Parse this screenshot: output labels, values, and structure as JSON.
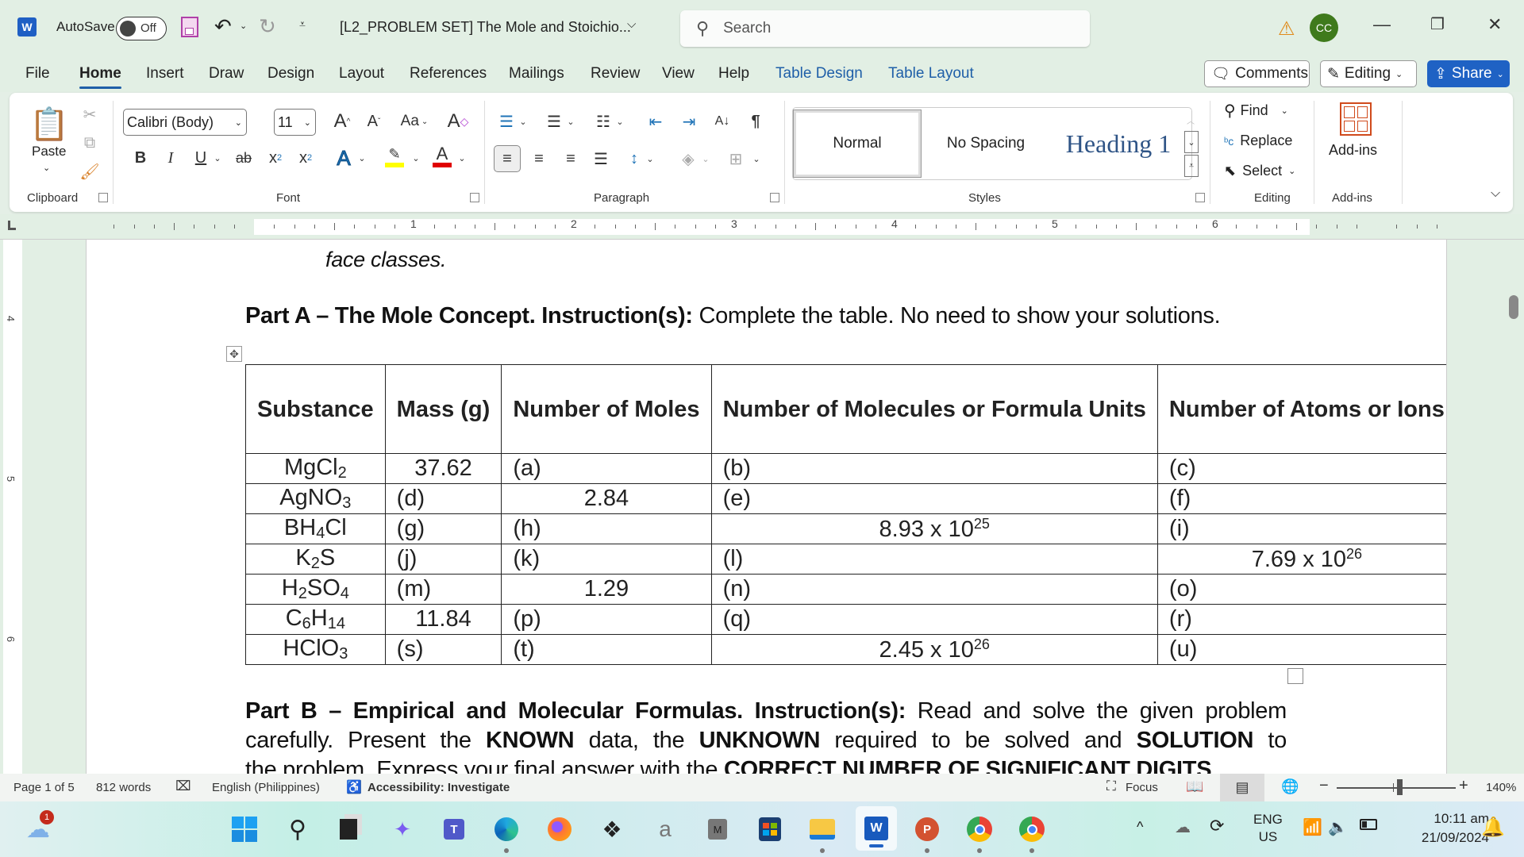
{
  "titlebar": {
    "app_icon": "word-icon",
    "autosave_label": "AutoSave",
    "autosave_state": "Off",
    "doc_title": "[L2_PROBLEM SET] The Mole and Stoichio...",
    "search_placeholder": "Search",
    "user_initials": "CC",
    "warning_icon": "warning-icon"
  },
  "menu": {
    "tabs": [
      "File",
      "Home",
      "Insert",
      "Draw",
      "Design",
      "Layout",
      "References",
      "Mailings",
      "Review",
      "View",
      "Help",
      "Table Design",
      "Table Layout"
    ],
    "active_tab": "Home",
    "comments_label": "Comments",
    "editing_label": "Editing",
    "share_label": "Share"
  },
  "ribbon": {
    "clipboard": {
      "paste_label": "Paste",
      "group_label": "Clipboard"
    },
    "font": {
      "font_name": "Calibri (Body)",
      "font_size": "11",
      "case_label": "Aa",
      "group_label": "Font",
      "highlight_color": "#ffff00",
      "font_color": "#e00000"
    },
    "paragraph": {
      "group_label": "Paragraph"
    },
    "styles": {
      "items": [
        "Normal",
        "No Spacing",
        "Heading 1"
      ],
      "selected": "Normal",
      "group_label": "Styles"
    },
    "editing": {
      "find_label": "Find",
      "replace_label": "Replace",
      "select_label": "Select",
      "group_label": "Editing"
    },
    "addins": {
      "label": "Add-ins",
      "group_label": "Add-ins"
    }
  },
  "ruler": {
    "h_numbers": [
      "1",
      "2",
      "3",
      "4",
      "5",
      "6"
    ],
    "v_numbers": [
      "4",
      "5",
      "6"
    ]
  },
  "document": {
    "prev_line_tail": "face classes.",
    "part_a_bold": "Part A – The Mole Concept. Instruction(s):",
    "part_a_rest": " Complete the table. No need to show your solutions.",
    "table": {
      "headers": [
        "Substance",
        "Mass (g)",
        "Number of Moles",
        "Number of Molecules or Formula Units",
        "Number of Atoms or Ions"
      ],
      "rows": [
        {
          "substance": [
            "MgCl",
            "2",
            ""
          ],
          "mass": "37.62",
          "moles": "(a)",
          "molecules": "(b)",
          "atoms": "(c)"
        },
        {
          "substance": [
            "AgNO",
            "3",
            ""
          ],
          "mass": "(d)",
          "moles": "2.84",
          "molecules": "(e)",
          "atoms": "(f)"
        },
        {
          "substance": [
            "BH",
            "4",
            "Cl"
          ],
          "mass": "(g)",
          "moles": "(h)",
          "molecules": "8.93 x 10^25",
          "atoms": "(i)"
        },
        {
          "substance": [
            "K",
            "2",
            "S"
          ],
          "mass": "(j)",
          "moles": "(k)",
          "molecules": "(l)",
          "atoms": "7.69 x 10^26"
        },
        {
          "substance": [
            "H",
            "2",
            "SO",
            "4"
          ],
          "mass": "(m)",
          "moles": "1.29",
          "molecules": "(n)",
          "atoms": "(o)"
        },
        {
          "substance": [
            "C",
            "6",
            "H",
            "14"
          ],
          "mass": "11.84",
          "moles": "(p)",
          "molecules": "(q)",
          "atoms": "(r)"
        },
        {
          "substance": [
            "HClO",
            "3",
            ""
          ],
          "mass": "(s)",
          "moles": "(t)",
          "molecules": "2.45 x 10^26",
          "atoms": "(u)"
        }
      ]
    },
    "part_b_bold": "Part B – Empirical and Molecular Formulas. Instruction(s):",
    "part_b_rest1": " Read and solve the given problem",
    "part_b_line2": [
      "carefully. Present the ",
      "KNOWN",
      " data, the ",
      "UNKNOWN",
      " required to be solved and ",
      "SOLUTION",
      " to"
    ],
    "part_b_line3": [
      "the problem. Express your final answer with the ",
      "CORRECT NUMBER OF SIGNIFICANT DIGITS"
    ]
  },
  "statusbar": {
    "page": "Page 1 of 5",
    "words": "812 words",
    "language": "English (Philippines)",
    "accessibility": "Accessibility: Investigate",
    "focus_label": "Focus",
    "zoom_percent": "140%",
    "zoom_value": 140
  },
  "taskbar": {
    "weather_badge": "1",
    "apps": [
      "start",
      "search",
      "task-view",
      "copilot",
      "teams",
      "edge",
      "firefox",
      "dropbox",
      "amazon",
      "m-app",
      "microsoft-store",
      "file-explorer",
      "word",
      "powerpoint",
      "chrome-profile-1",
      "chrome-profile-2"
    ],
    "lang_top": "ENG",
    "lang_bottom": "US",
    "time": "10:11 am",
    "date": "21/09/2024"
  }
}
